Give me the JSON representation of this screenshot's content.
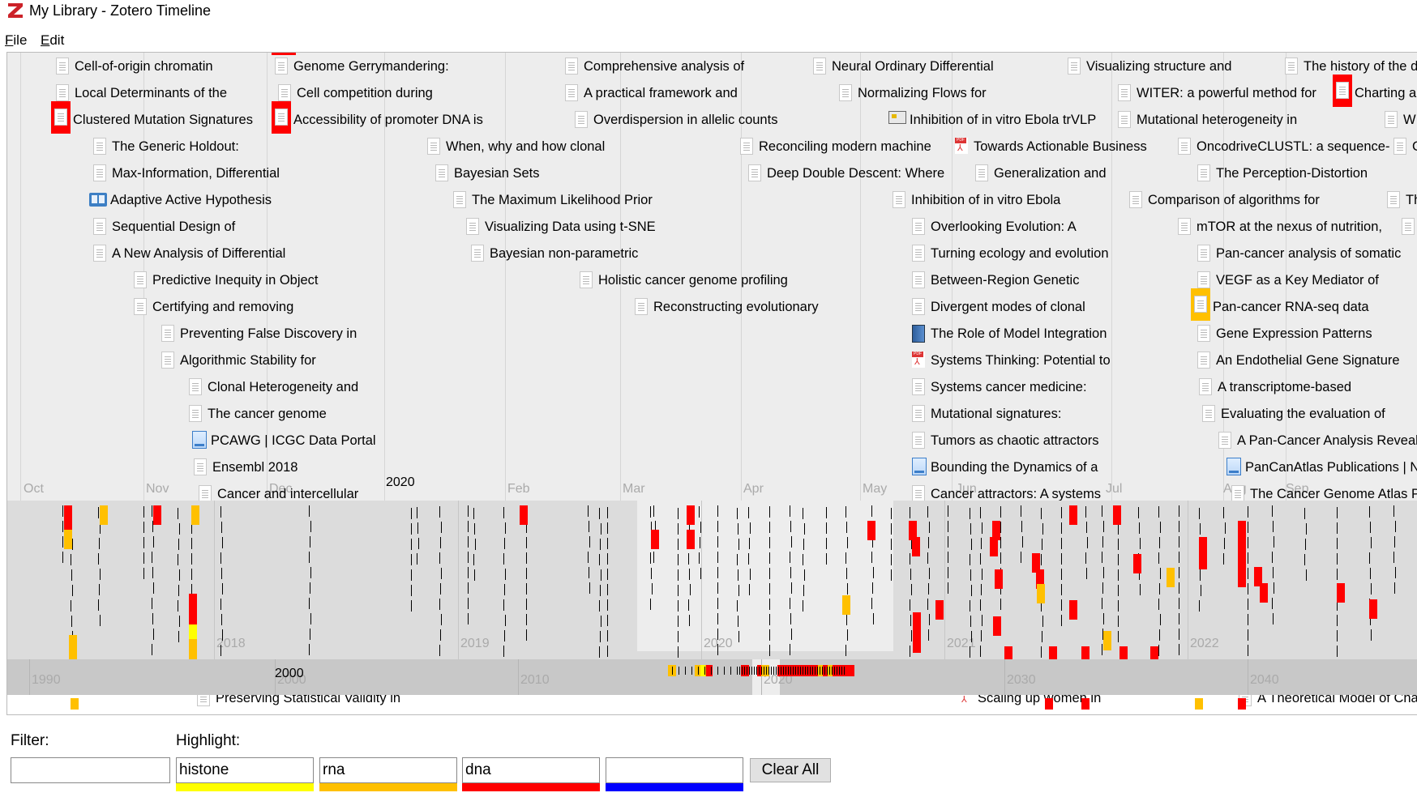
{
  "window": {
    "title": "My Library - Zotero Timeline",
    "app_icon": "zotero-z-icon"
  },
  "menu": [
    {
      "label": "File",
      "accel": "F"
    },
    {
      "label": "Edit",
      "accel": "E"
    }
  ],
  "timeline": {
    "month_labels": [
      "Oct",
      "Nov",
      "Dec",
      "Feb",
      "Mar",
      "Apr",
      "May",
      "Jun",
      "Jul",
      "Aug",
      "Sep"
    ],
    "upper_year_label": "2020",
    "detail_year_labels": [
      "2018",
      "2019",
      "2020",
      "2021",
      "2022"
    ],
    "overview_year_labels": [
      "1990",
      "2000",
      "2010",
      "2020",
      "2030",
      "2040"
    ],
    "overview_bold_label": "2000",
    "items": [
      {
        "title": "Cell-of-origin chromatin",
        "icon": "document",
        "highlight": null
      },
      {
        "title": "Local Determinants of the",
        "icon": "document",
        "highlight": null
      },
      {
        "title": "Clustered Mutation Signatures",
        "icon": "document",
        "highlight": "dna"
      },
      {
        "title": "The Generic Holdout:",
        "icon": "document",
        "highlight": null
      },
      {
        "title": "Max-Information, Differential",
        "icon": "document",
        "highlight": null
      },
      {
        "title": "Adaptive Active Hypothesis",
        "icon": "book",
        "highlight": null
      },
      {
        "title": "Sequential Design of",
        "icon": "document",
        "highlight": null
      },
      {
        "title": "A New Analysis of Differential",
        "icon": "document",
        "highlight": null
      },
      {
        "title": "Predictive Inequity in Object",
        "icon": "document",
        "highlight": null
      },
      {
        "title": "Certifying and removing",
        "icon": "document",
        "highlight": null
      },
      {
        "title": "Preventing False Discovery in",
        "icon": "document",
        "highlight": null
      },
      {
        "title": "Algorithmic Stability for",
        "icon": "document",
        "highlight": null
      },
      {
        "title": "Clonal Heterogeneity and",
        "icon": "document",
        "highlight": null
      },
      {
        "title": "The cancer genome",
        "icon": "document",
        "highlight": null
      },
      {
        "title": "PCAWG | ICGC Data Portal",
        "icon": "webpage",
        "highlight": null
      },
      {
        "title": "Ensembl 2018",
        "icon": "document",
        "highlight": null
      },
      {
        "title": "Cancer and intercellular",
        "icon": "document",
        "highlight": null
      },
      {
        "title": "Genome Gerrymandering:",
        "icon": "document",
        "highlight": null
      },
      {
        "title": "Cell competition during",
        "icon": "document",
        "highlight": null
      },
      {
        "title": "Accessibility of promoter DNA is",
        "icon": "document",
        "highlight": "dna"
      },
      {
        "title": "When, why and how clonal",
        "icon": "document",
        "highlight": null
      },
      {
        "title": "Bayesian Sets",
        "icon": "document",
        "highlight": null
      },
      {
        "title": "The Maximum Likelihood Prior",
        "icon": "document",
        "highlight": null
      },
      {
        "title": "Visualizing Data using t-SNE",
        "icon": "document",
        "highlight": null
      },
      {
        "title": "Bayesian non-parametric",
        "icon": "document",
        "highlight": null
      },
      {
        "title": "Comprehensive analysis of",
        "icon": "document",
        "highlight": null
      },
      {
        "title": "A practical framework and",
        "icon": "document",
        "highlight": null
      },
      {
        "title": "Overdispersion in allelic counts",
        "icon": "document",
        "highlight": null
      },
      {
        "title": "Holistic cancer genome profiling",
        "icon": "document",
        "highlight": null
      },
      {
        "title": "Reconstructing evolutionary",
        "icon": "document",
        "highlight": null
      },
      {
        "title": "Neural Ordinary Differential",
        "icon": "document",
        "highlight": null
      },
      {
        "title": "Normalizing Flows for",
        "icon": "document",
        "highlight": null
      },
      {
        "title": "Inhibition of in vitro Ebola trVLP",
        "icon": "presentation",
        "highlight": null
      },
      {
        "title": "Reconciling modern machine",
        "icon": "document",
        "highlight": null
      },
      {
        "title": "Towards Actionable Business",
        "icon": "pdf",
        "highlight": null
      },
      {
        "title": "Deep Double Descent: Where",
        "icon": "document",
        "highlight": null
      },
      {
        "title": "Generalization and",
        "icon": "document",
        "highlight": null
      },
      {
        "title": "Inhibition of in vitro Ebola",
        "icon": "document",
        "highlight": null
      },
      {
        "title": "Overlooking Evolution: A",
        "icon": "document",
        "highlight": null
      },
      {
        "title": "Turning ecology and evolution",
        "icon": "document",
        "highlight": null
      },
      {
        "title": "Between-Region Genetic",
        "icon": "document",
        "highlight": null
      },
      {
        "title": "Divergent modes of clonal",
        "icon": "document",
        "highlight": null
      },
      {
        "title": "The Role of Model Integration",
        "icon": "book-blue",
        "highlight": null
      },
      {
        "title": "Systems Thinking: Potential to",
        "icon": "pdf",
        "highlight": null
      },
      {
        "title": "Systems cancer medicine:",
        "icon": "document",
        "highlight": null
      },
      {
        "title": "Mutational signatures:",
        "icon": "document",
        "highlight": null
      },
      {
        "title": "Tumors as chaotic attractors",
        "icon": "document",
        "highlight": null
      },
      {
        "title": "Bounding the Dynamics of a",
        "icon": "webpage",
        "highlight": null
      },
      {
        "title": "Cancer attractors: A systems",
        "icon": "document",
        "highlight": null
      },
      {
        "title": "Visualizing structure and",
        "icon": "document",
        "highlight": null
      },
      {
        "title": "WITER: a powerful method for",
        "icon": "document",
        "highlight": null
      },
      {
        "title": "Mutational heterogeneity in",
        "icon": "document",
        "highlight": null
      },
      {
        "title": "OncodriveCLUSTL: a sequence-",
        "icon": "document",
        "highlight": null
      },
      {
        "title": "The Perception-Distortion",
        "icon": "document",
        "highlight": null
      },
      {
        "title": "Comparison of algorithms for",
        "icon": "document",
        "highlight": null
      },
      {
        "title": "mTOR at the nexus of nutrition,",
        "icon": "document",
        "highlight": null
      },
      {
        "title": "Pan-cancer analysis of somatic",
        "icon": "document",
        "highlight": null
      },
      {
        "title": "VEGF as a Key Mediator of",
        "icon": "document",
        "highlight": null
      },
      {
        "title": "Pan-cancer RNA-seq data",
        "icon": "document",
        "highlight": "rna"
      },
      {
        "title": "Gene Expression Patterns",
        "icon": "document",
        "highlight": null
      },
      {
        "title": "An Endothelial Gene Signature",
        "icon": "document",
        "highlight": null
      },
      {
        "title": "A transcriptome-based",
        "icon": "document",
        "highlight": null
      },
      {
        "title": "Evaluating the evaluation of",
        "icon": "document",
        "highlight": null
      },
      {
        "title": "A Pan-Cancer Analysis Reveals",
        "icon": "document",
        "highlight": null
      },
      {
        "title": "PanCanAtlas Publications | NC",
        "icon": "webpage",
        "highlight": null
      },
      {
        "title": "The Cancer Genome Atlas Pa",
        "icon": "document",
        "highlight": null
      },
      {
        "title": "The history of the d",
        "icon": "document",
        "highlight": null
      },
      {
        "title": "Charting a",
        "icon": "document",
        "highlight": "dna"
      },
      {
        "title": "W",
        "icon": "document",
        "highlight": null
      },
      {
        "title": "G",
        "icon": "document",
        "highlight": null
      },
      {
        "title": "Th",
        "icon": "document",
        "highlight": null
      },
      {
        "title": "T",
        "icon": "document",
        "highlight": null
      }
    ],
    "bottom_items": [
      {
        "title": "Preserving Statistical Validity in",
        "icon": "document"
      },
      {
        "title": "Scaling up women in",
        "icon": "pdf"
      },
      {
        "title": "A Theoretical Model of Chao",
        "icon": "document"
      }
    ]
  },
  "controls": {
    "filter_label": "Filter:",
    "filter_value": "",
    "highlight_label": "Highlight:",
    "highlights": [
      {
        "value": "histone",
        "color": "#ffff00"
      },
      {
        "value": "rna",
        "color": "#ffc000"
      },
      {
        "value": "dna",
        "color": "#ff0000"
      },
      {
        "value": "",
        "color": "#0000ff"
      }
    ],
    "clear_all_label": "Clear All"
  }
}
